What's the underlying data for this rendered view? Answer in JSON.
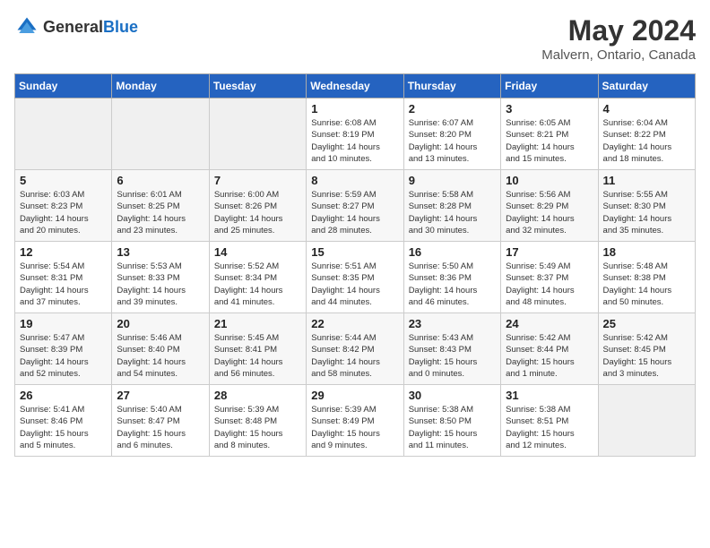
{
  "header": {
    "logo_general": "General",
    "logo_blue": "Blue",
    "month": "May 2024",
    "location": "Malvern, Ontario, Canada"
  },
  "weekdays": [
    "Sunday",
    "Monday",
    "Tuesday",
    "Wednesday",
    "Thursday",
    "Friday",
    "Saturday"
  ],
  "weeks": [
    [
      {
        "day": "",
        "info": ""
      },
      {
        "day": "",
        "info": ""
      },
      {
        "day": "",
        "info": ""
      },
      {
        "day": "1",
        "info": "Sunrise: 6:08 AM\nSunset: 8:19 PM\nDaylight: 14 hours\nand 10 minutes."
      },
      {
        "day": "2",
        "info": "Sunrise: 6:07 AM\nSunset: 8:20 PM\nDaylight: 14 hours\nand 13 minutes."
      },
      {
        "day": "3",
        "info": "Sunrise: 6:05 AM\nSunset: 8:21 PM\nDaylight: 14 hours\nand 15 minutes."
      },
      {
        "day": "4",
        "info": "Sunrise: 6:04 AM\nSunset: 8:22 PM\nDaylight: 14 hours\nand 18 minutes."
      }
    ],
    [
      {
        "day": "5",
        "info": "Sunrise: 6:03 AM\nSunset: 8:23 PM\nDaylight: 14 hours\nand 20 minutes."
      },
      {
        "day": "6",
        "info": "Sunrise: 6:01 AM\nSunset: 8:25 PM\nDaylight: 14 hours\nand 23 minutes."
      },
      {
        "day": "7",
        "info": "Sunrise: 6:00 AM\nSunset: 8:26 PM\nDaylight: 14 hours\nand 25 minutes."
      },
      {
        "day": "8",
        "info": "Sunrise: 5:59 AM\nSunset: 8:27 PM\nDaylight: 14 hours\nand 28 minutes."
      },
      {
        "day": "9",
        "info": "Sunrise: 5:58 AM\nSunset: 8:28 PM\nDaylight: 14 hours\nand 30 minutes."
      },
      {
        "day": "10",
        "info": "Sunrise: 5:56 AM\nSunset: 8:29 PM\nDaylight: 14 hours\nand 32 minutes."
      },
      {
        "day": "11",
        "info": "Sunrise: 5:55 AM\nSunset: 8:30 PM\nDaylight: 14 hours\nand 35 minutes."
      }
    ],
    [
      {
        "day": "12",
        "info": "Sunrise: 5:54 AM\nSunset: 8:31 PM\nDaylight: 14 hours\nand 37 minutes."
      },
      {
        "day": "13",
        "info": "Sunrise: 5:53 AM\nSunset: 8:33 PM\nDaylight: 14 hours\nand 39 minutes."
      },
      {
        "day": "14",
        "info": "Sunrise: 5:52 AM\nSunset: 8:34 PM\nDaylight: 14 hours\nand 41 minutes."
      },
      {
        "day": "15",
        "info": "Sunrise: 5:51 AM\nSunset: 8:35 PM\nDaylight: 14 hours\nand 44 minutes."
      },
      {
        "day": "16",
        "info": "Sunrise: 5:50 AM\nSunset: 8:36 PM\nDaylight: 14 hours\nand 46 minutes."
      },
      {
        "day": "17",
        "info": "Sunrise: 5:49 AM\nSunset: 8:37 PM\nDaylight: 14 hours\nand 48 minutes."
      },
      {
        "day": "18",
        "info": "Sunrise: 5:48 AM\nSunset: 8:38 PM\nDaylight: 14 hours\nand 50 minutes."
      }
    ],
    [
      {
        "day": "19",
        "info": "Sunrise: 5:47 AM\nSunset: 8:39 PM\nDaylight: 14 hours\nand 52 minutes."
      },
      {
        "day": "20",
        "info": "Sunrise: 5:46 AM\nSunset: 8:40 PM\nDaylight: 14 hours\nand 54 minutes."
      },
      {
        "day": "21",
        "info": "Sunrise: 5:45 AM\nSunset: 8:41 PM\nDaylight: 14 hours\nand 56 minutes."
      },
      {
        "day": "22",
        "info": "Sunrise: 5:44 AM\nSunset: 8:42 PM\nDaylight: 14 hours\nand 58 minutes."
      },
      {
        "day": "23",
        "info": "Sunrise: 5:43 AM\nSunset: 8:43 PM\nDaylight: 15 hours\nand 0 minutes."
      },
      {
        "day": "24",
        "info": "Sunrise: 5:42 AM\nSunset: 8:44 PM\nDaylight: 15 hours\nand 1 minute."
      },
      {
        "day": "25",
        "info": "Sunrise: 5:42 AM\nSunset: 8:45 PM\nDaylight: 15 hours\nand 3 minutes."
      }
    ],
    [
      {
        "day": "26",
        "info": "Sunrise: 5:41 AM\nSunset: 8:46 PM\nDaylight: 15 hours\nand 5 minutes."
      },
      {
        "day": "27",
        "info": "Sunrise: 5:40 AM\nSunset: 8:47 PM\nDaylight: 15 hours\nand 6 minutes."
      },
      {
        "day": "28",
        "info": "Sunrise: 5:39 AM\nSunset: 8:48 PM\nDaylight: 15 hours\nand 8 minutes."
      },
      {
        "day": "29",
        "info": "Sunrise: 5:39 AM\nSunset: 8:49 PM\nDaylight: 15 hours\nand 9 minutes."
      },
      {
        "day": "30",
        "info": "Sunrise: 5:38 AM\nSunset: 8:50 PM\nDaylight: 15 hours\nand 11 minutes."
      },
      {
        "day": "31",
        "info": "Sunrise: 5:38 AM\nSunset: 8:51 PM\nDaylight: 15 hours\nand 12 minutes."
      },
      {
        "day": "",
        "info": ""
      }
    ]
  ]
}
